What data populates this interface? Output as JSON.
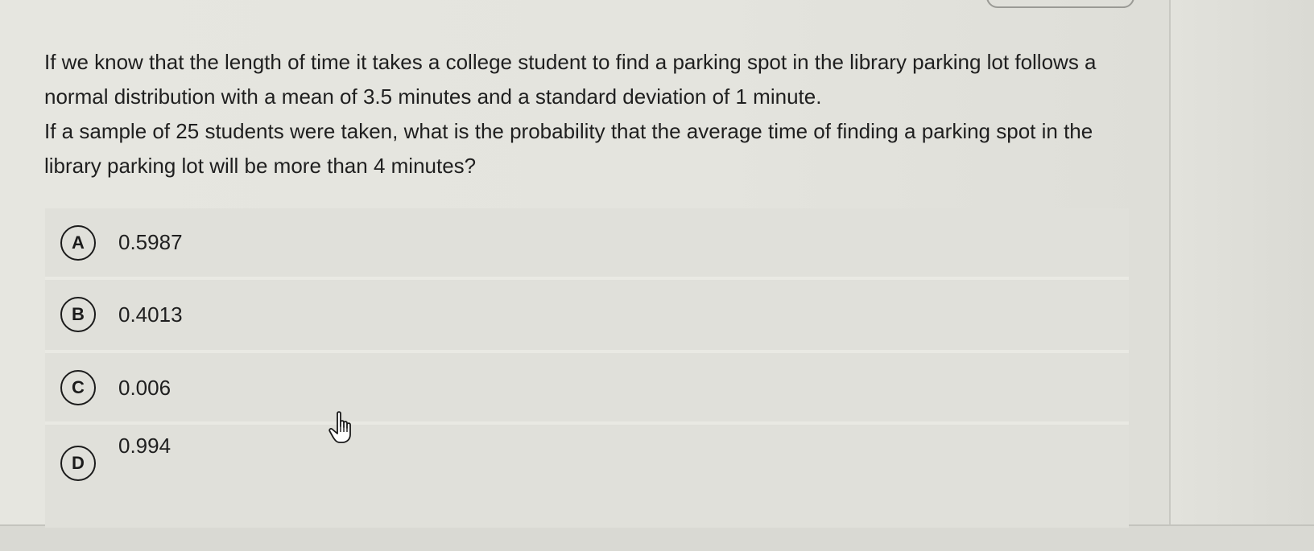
{
  "question": {
    "line1": "If we know that the length of time it takes a college student to find a parking spot in the library parking lot follows a normal distribution with a mean of 3.5 minutes and a standard deviation of 1 minute.",
    "line2": "If a sample of 25 students were taken, what is the probability that the average time of finding a parking spot in the library parking lot will be more than 4 minutes?"
  },
  "options": [
    {
      "letter": "A",
      "value": "0.5987"
    },
    {
      "letter": "B",
      "value": "0.4013"
    },
    {
      "letter": "C",
      "value": "0.006"
    },
    {
      "letter": "D",
      "value": "0.994"
    }
  ],
  "cursor_icon": "hand-pointer-icon"
}
